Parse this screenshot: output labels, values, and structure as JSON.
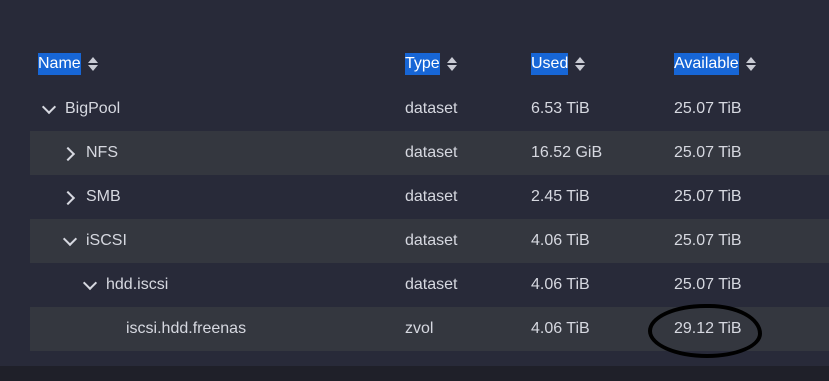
{
  "columns": {
    "name": "Name",
    "type": "Type",
    "used": "Used",
    "available": "Available"
  },
  "rows": [
    {
      "name": "BigPool",
      "expander": "chevron-down",
      "type": "dataset",
      "used": "6.53 TiB",
      "available": "25.07 TiB"
    },
    {
      "name": "NFS",
      "expander": "chevron-right",
      "type": "dataset",
      "used": "16.52 GiB",
      "available": "25.07 TiB"
    },
    {
      "name": "SMB",
      "expander": "chevron-right",
      "type": "dataset",
      "used": "2.45 TiB",
      "available": "25.07 TiB"
    },
    {
      "name": "iSCSI",
      "expander": "chevron-down",
      "type": "dataset",
      "used": "4.06 TiB",
      "available": "25.07 TiB"
    },
    {
      "name": "hdd.iscsi",
      "expander": "chevron-down",
      "type": "dataset",
      "used": "4.06 TiB",
      "available": "25.07 TiB"
    },
    {
      "name": "iscsi.hdd.freenas",
      "expander": "",
      "type": "zvol",
      "used": "4.06 TiB",
      "available": "29.12 TiB"
    }
  ],
  "colors": {
    "background": "#282a39",
    "header_highlight": "#1766d6",
    "row_shaded": "#34373f",
    "text": "#d6d8e0",
    "annotation": "#000000"
  }
}
